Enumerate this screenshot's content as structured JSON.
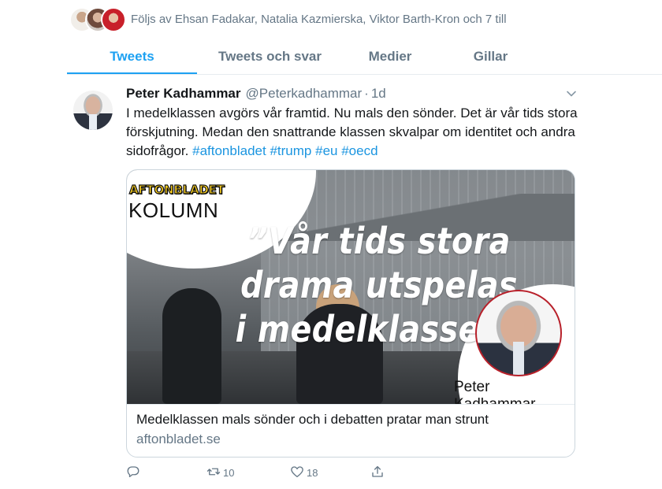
{
  "followed": {
    "text": "Följs av Ehsan Fadakar, Natalia Kazmierska, Viktor Barth-Kron och 7 till",
    "avatars": [
      "avatar-1",
      "avatar-2",
      "avatar-3"
    ]
  },
  "tabs": [
    {
      "label": "Tweets",
      "active": true
    },
    {
      "label": "Tweets och svar",
      "active": false
    },
    {
      "label": "Medier",
      "active": false
    },
    {
      "label": "Gillar",
      "active": false
    }
  ],
  "tweet": {
    "name": "Peter Kadhammar",
    "handle": "@Peterkadhammar",
    "separator": "·",
    "time": "1d",
    "text": "I medelklassen avgörs vår framtid. Nu mals den sönder. Det är vår tids stora förskjutning. Medan den snattrande klassen skvalpar om identitet och andra sidofrågor.",
    "hashtags": [
      "#aftonbladet",
      "#trump",
      "#eu",
      "#oecd"
    ],
    "card": {
      "brand": "AFTONBLADET",
      "section": "KOLUMN",
      "headline_lines": [
        "”Vår tids stora",
        "drama utspelas",
        "i medelklassen”"
      ],
      "portrait_name": "Peter Kadhammar",
      "title": "Medelklassen mals sönder och i debatten pratar man strunt",
      "domain": "aftonbladet.se"
    },
    "actions": {
      "reply_count": "",
      "retweet_count": "10",
      "like_count": "18"
    }
  },
  "colors": {
    "accent": "#1da1f2",
    "hashtag": "#1b95e0",
    "muted": "#657786",
    "brand_yellow": "#ffd21e"
  }
}
